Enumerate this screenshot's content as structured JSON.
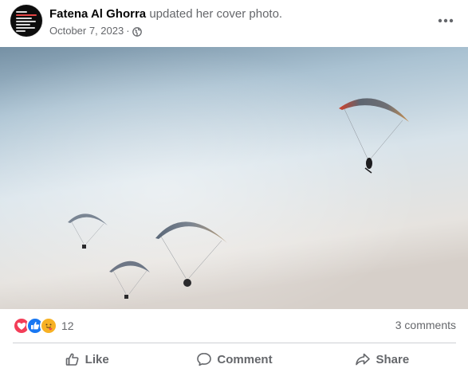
{
  "post": {
    "author": "Fatena Al Ghorra",
    "action_text": "updated her cover photo.",
    "date": "October 7, 2023",
    "separator": "·",
    "privacy_icon": "globe-icon",
    "more_icon": "more-horizontal-icon"
  },
  "photo": {
    "subject": "paragliders",
    "sky_colors": [
      "#6e8699",
      "#b9cedc",
      "#e8ecf0",
      "#d7d2cc"
    ]
  },
  "engagement": {
    "reaction_icons": [
      "love-icon",
      "like-icon",
      "care-icon"
    ],
    "reaction_count": "12",
    "comments": "3 comments"
  },
  "actions": {
    "like": "Like",
    "comment": "Comment",
    "share": "Share"
  },
  "colors": {
    "like_blue": "#1877f2",
    "love_red": "#f33e58",
    "care_yellow": "#f7b125",
    "secondary_text": "#65676b"
  }
}
